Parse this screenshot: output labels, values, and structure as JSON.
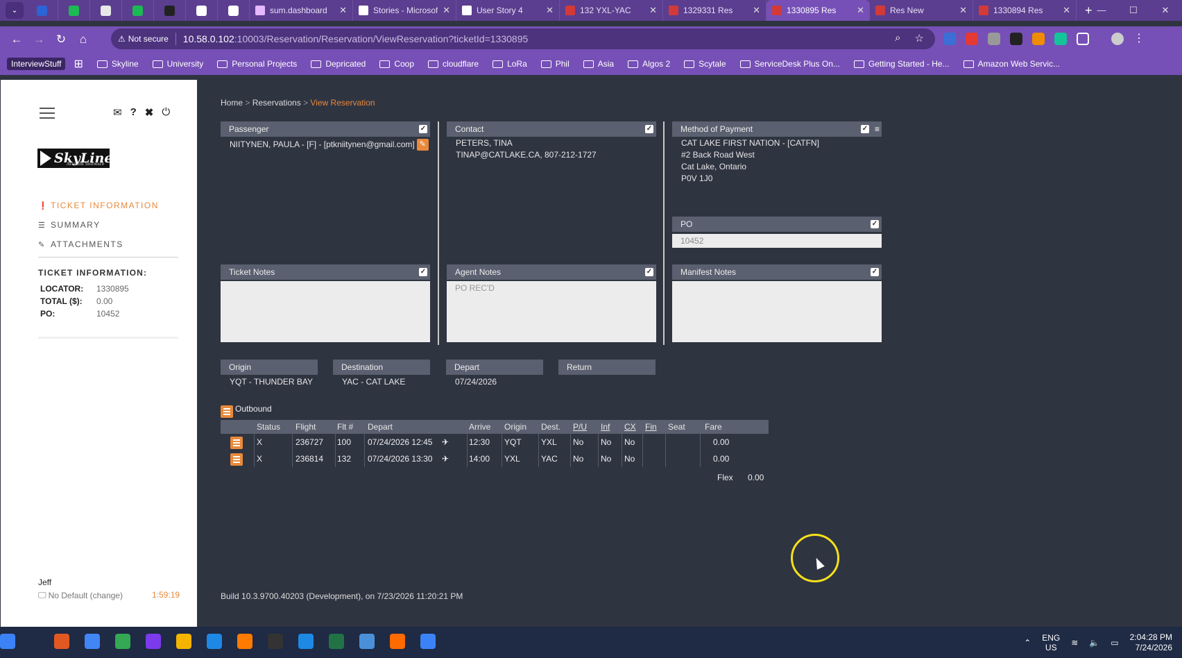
{
  "browser": {
    "tabs": [
      {
        "title": "sum.dashboard",
        "color": "#e6b8ff"
      },
      {
        "title": "Stories - Microsoft",
        "color": "#ffffff"
      },
      {
        "title": "User Story 4",
        "color": "#ffffff"
      },
      {
        "title": "132 YXL-YAC",
        "color": "#d23a3a"
      },
      {
        "title": "1329331 Res",
        "color": "#d23a3a"
      },
      {
        "title": "1330895 Res",
        "color": "#d23a3a",
        "active": true
      },
      {
        "title": "Res New",
        "color": "#d23a3a"
      },
      {
        "title": "1330894 Res",
        "color": "#d23a3a"
      }
    ],
    "mini_tabs": [
      "#2c63d6",
      "#1db954",
      "#e8e8e8",
      "#1db954",
      "#222222",
      "#ffffff",
      "#ffffff"
    ],
    "not_secure": "Not secure",
    "url_host": "10.58.0.102",
    "url_rest": ":10003/Reservation/Reservation/ViewReservation?ticketId=1330895",
    "bookmarks": [
      "InterviewStuff",
      "Skyline",
      "University",
      "Personal Projects",
      "Depricated",
      "Coop",
      "cloudflare",
      "LoRa",
      "Phil",
      "Asia",
      "Algos 2",
      "Scytale",
      "ServiceDesk Plus On...",
      "Getting Started - He...",
      "Amazon Web Servic..."
    ]
  },
  "sidebar": {
    "nav": [
      {
        "label": "TICKET INFORMATION",
        "icon": "info-icon"
      },
      {
        "label": "SUMMARY",
        "icon": "list-icon"
      },
      {
        "label": "ATTACHMENTS",
        "icon": "paperclip-icon"
      }
    ],
    "logo_text": "SkyLine",
    "logo_sub": "Aviation Software",
    "info_title": "TICKET INFORMATION:",
    "info": [
      {
        "k": "LOCATOR:",
        "v": "1330895"
      },
      {
        "k": "TOTAL ($):",
        "v": "0.00"
      },
      {
        "k": "PO:",
        "v": "10452"
      }
    ],
    "user": "Jeff",
    "user_sub": "No Default (change)",
    "timer": "1:59:19"
  },
  "breadcrumb": {
    "home": "Home",
    "reservations": "Reservations",
    "current": "View Reservation"
  },
  "passenger": {
    "header": "Passenger",
    "value": "NIITYNEN, PAULA - [F] - [ptkniitynen@gmail.com]"
  },
  "contact": {
    "header": "Contact",
    "name": "PETERS, TINA",
    "details": "TINAP@CATLAKE.CA, 807-212-1727"
  },
  "payment": {
    "header": "Method of Payment",
    "line1": "CAT LAKE FIRST NATION - [CATFN]",
    "line2": "#2 Back Road West",
    "line3": "Cat Lake, Ontario",
    "line4": "P0V 1J0"
  },
  "po": {
    "header": "PO",
    "value": "10452"
  },
  "ticket_notes": {
    "header": "Ticket Notes",
    "value": ""
  },
  "agent_notes": {
    "header": "Agent Notes",
    "value": "PO REC'D"
  },
  "manifest_notes": {
    "header": "Manifest Notes",
    "value": ""
  },
  "route": {
    "origin_label": "Origin",
    "origin": "YQT - THUNDER BAY",
    "dest_label": "Destination",
    "dest": "YAC - CAT LAKE",
    "depart_label": "Depart",
    "depart": "07/24/2026",
    "return_label": "Return",
    "return": ""
  },
  "outbound": {
    "label": "Outbound",
    "columns": [
      "Status",
      "Flight",
      "Flt #",
      "Depart",
      "Arrive",
      "Origin",
      "Dest.",
      "P/U",
      "Inf",
      "CX",
      "Fin",
      "Seat",
      "Fare"
    ],
    "rows": [
      {
        "status": "X",
        "flight": "236727",
        "flt": "100",
        "depart": "07/24/2026 12:45",
        "arrive": "12:30",
        "origin": "YQT",
        "dest": "YXL",
        "pu": "No",
        "inf": "No",
        "cx": "No",
        "fin": "",
        "seat": "",
        "fare": "0.00"
      },
      {
        "status": "X",
        "flight": "236814",
        "flt": "132",
        "depart": "07/24/2026 13:30",
        "arrive": "14:00",
        "origin": "YXL",
        "dest": "YAC",
        "pu": "No",
        "inf": "No",
        "cx": "No",
        "fin": "",
        "seat": "",
        "fare": "0.00"
      }
    ],
    "flex_label": "Flex",
    "flex_value": "0.00"
  },
  "build": "Build 10.3.9700.40203 (Development), on 7/23/2026 11:20:21 PM",
  "taskbar": {
    "lang1": "ENG",
    "lang2": "US",
    "time": "2:04:28 PM",
    "date": "7/24/2026",
    "icons": [
      "#3b82f6",
      "#e25822",
      "#4285f4",
      "#34a853",
      "#7c3aed",
      "#f4b400",
      "#1e88e5",
      "#ff7a00",
      "#333333",
      "#1e88e5",
      "#217346",
      "#4a90d9",
      "#ff6a00",
      "#3b82f6"
    ]
  }
}
